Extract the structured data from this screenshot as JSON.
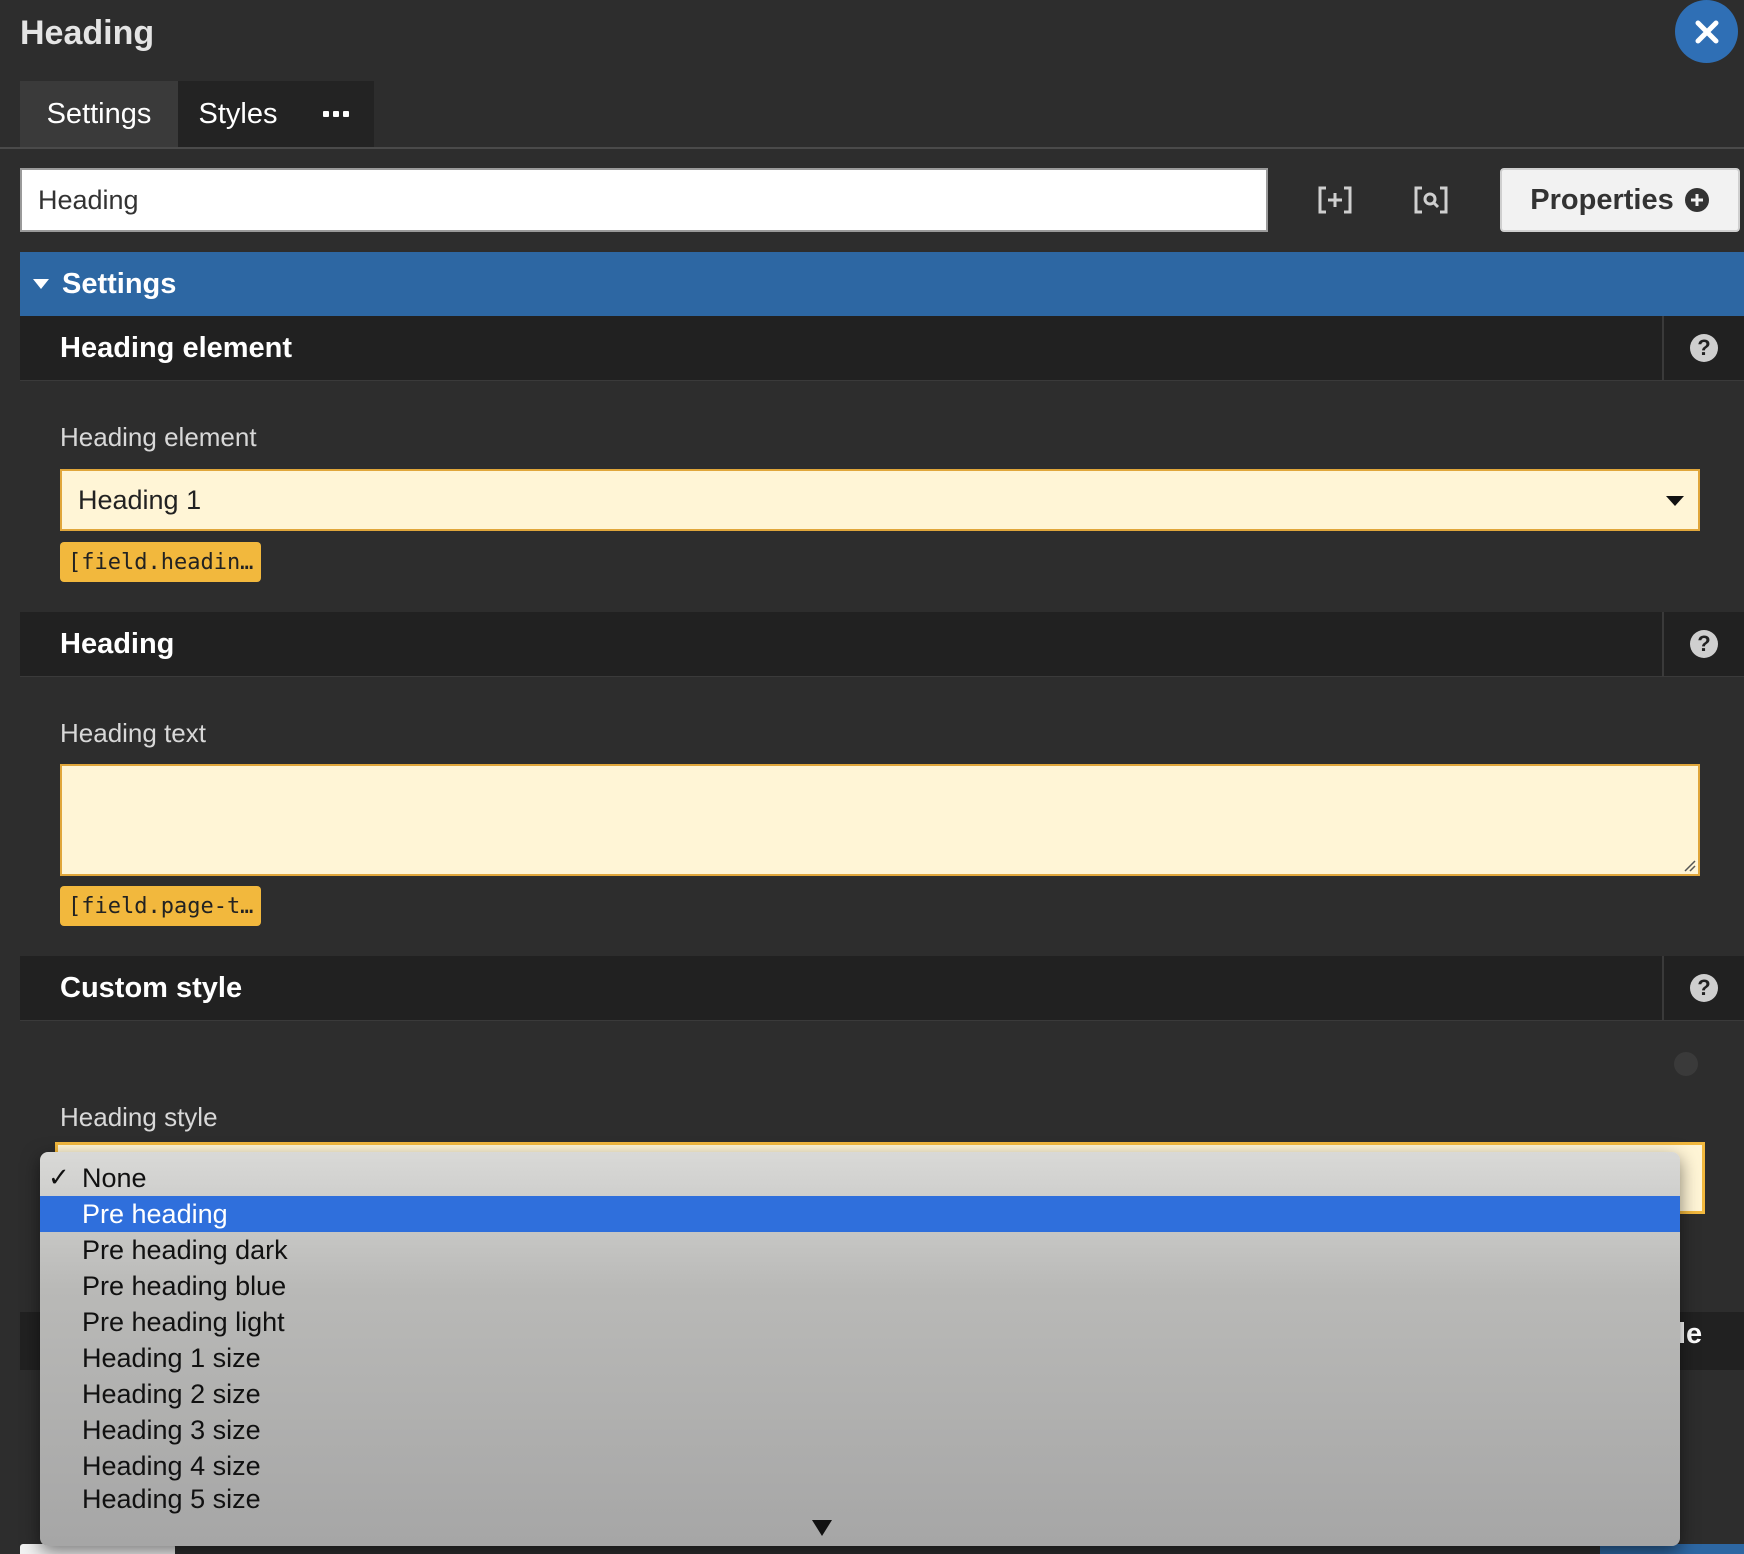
{
  "window": {
    "title": "Heading"
  },
  "tabs": [
    {
      "label": "Settings",
      "active": true
    },
    {
      "label": "Styles",
      "active": false
    }
  ],
  "toolbar": {
    "name_value": "Heading",
    "properties_label": "Properties"
  },
  "settings_panel": {
    "title": "Settings",
    "sections": [
      {
        "title": "Heading element",
        "field_label": "Heading element",
        "value": "Heading 1",
        "token": "[field.headin…"
      },
      {
        "title": "Heading",
        "field_label": "Heading text",
        "value": "",
        "token": "[field.page-t…"
      },
      {
        "title": "Custom style",
        "field_label": "Heading style"
      }
    ],
    "peek_text": "le"
  },
  "dropdown": {
    "selected_value": "None",
    "highlighted": "Pre heading",
    "options": [
      "None",
      "Pre heading",
      "Pre heading dark",
      "Pre heading blue",
      "Pre heading light",
      "Heading 1 size",
      "Heading 2 size",
      "Heading 3 size",
      "Heading 4 size",
      "Heading 5 size"
    ]
  },
  "colors": {
    "accent_blue": "#2d67a3",
    "field_bg": "#fff5d6",
    "field_border": "#e0a63b",
    "token_bg": "#f2b83d",
    "highlight": "#2f6fdc"
  }
}
